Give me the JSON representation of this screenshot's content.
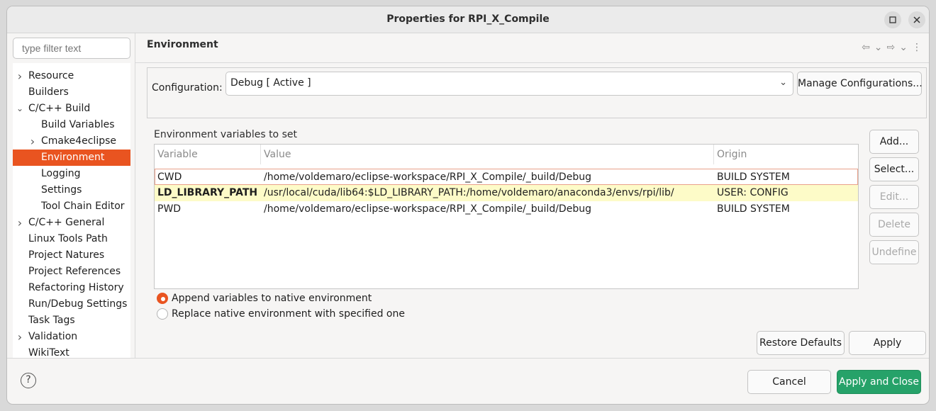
{
  "window": {
    "title": "Properties for RPI_X_Compile"
  },
  "filter": {
    "placeholder": "type filter text"
  },
  "tree": [
    {
      "label": "Resource",
      "twisty": "right"
    },
    {
      "label": "Builders",
      "twisty": ""
    },
    {
      "label": "C/C++ Build",
      "twisty": "down"
    },
    {
      "label": "Build Variables",
      "twisty": ""
    },
    {
      "label": "Cmake4eclipse",
      "twisty": "right"
    },
    {
      "label": "Environment",
      "twisty": "",
      "selected": true
    },
    {
      "label": "Logging",
      "twisty": ""
    },
    {
      "label": "Settings",
      "twisty": ""
    },
    {
      "label": "Tool Chain Editor",
      "twisty": ""
    },
    {
      "label": "C/C++ General",
      "twisty": "right"
    },
    {
      "label": "Linux Tools Path",
      "twisty": ""
    },
    {
      "label": "Project Natures",
      "twisty": ""
    },
    {
      "label": "Project References",
      "twisty": ""
    },
    {
      "label": "Refactoring History",
      "twisty": ""
    },
    {
      "label": "Run/Debug Settings",
      "twisty": ""
    },
    {
      "label": "Task Tags",
      "twisty": ""
    },
    {
      "label": "Validation",
      "twisty": "right"
    },
    {
      "label": "WikiText",
      "twisty": ""
    }
  ],
  "page": {
    "title": "Environment"
  },
  "config": {
    "label": "Configuration:",
    "value": "Debug  [ Active ]",
    "manage_label": "Manage Configurations..."
  },
  "env": {
    "section_label": "Environment variables to set",
    "headers": {
      "variable": "Variable",
      "value": "Value",
      "origin": "Origin"
    },
    "rows": [
      {
        "variable": "CWD",
        "value": "/home/voldemaro/eclipse-workspace/RPI_X_Compile/_build/Debug",
        "origin": "BUILD SYSTEM"
      },
      {
        "variable": "LD_LIBRARY_PATH",
        "value": "/usr/local/cuda/lib64:$LD_LIBRARY_PATH:/home/voldemaro/anaconda3/envs/rpi/lib/",
        "origin": "USER: CONFIG"
      },
      {
        "variable": "PWD",
        "value": "/home/voldemaro/eclipse-workspace/RPI_X_Compile/_build/Debug",
        "origin": "BUILD SYSTEM"
      }
    ],
    "buttons": {
      "add": "Add...",
      "select": "Select...",
      "edit": "Edit...",
      "delete": "Delete",
      "undefine": "Undefine"
    }
  },
  "mode": {
    "append": "Append variables to native environment",
    "replace": "Replace native environment with specified one",
    "selected": "append"
  },
  "actions": {
    "restore": "Restore Defaults",
    "apply": "Apply"
  },
  "footer": {
    "help": "?",
    "cancel": "Cancel",
    "apply_close": "Apply and Close"
  },
  "colors": {
    "accent": "#e95420",
    "primary": "#26a269",
    "user_row": "#fdfbc8"
  }
}
